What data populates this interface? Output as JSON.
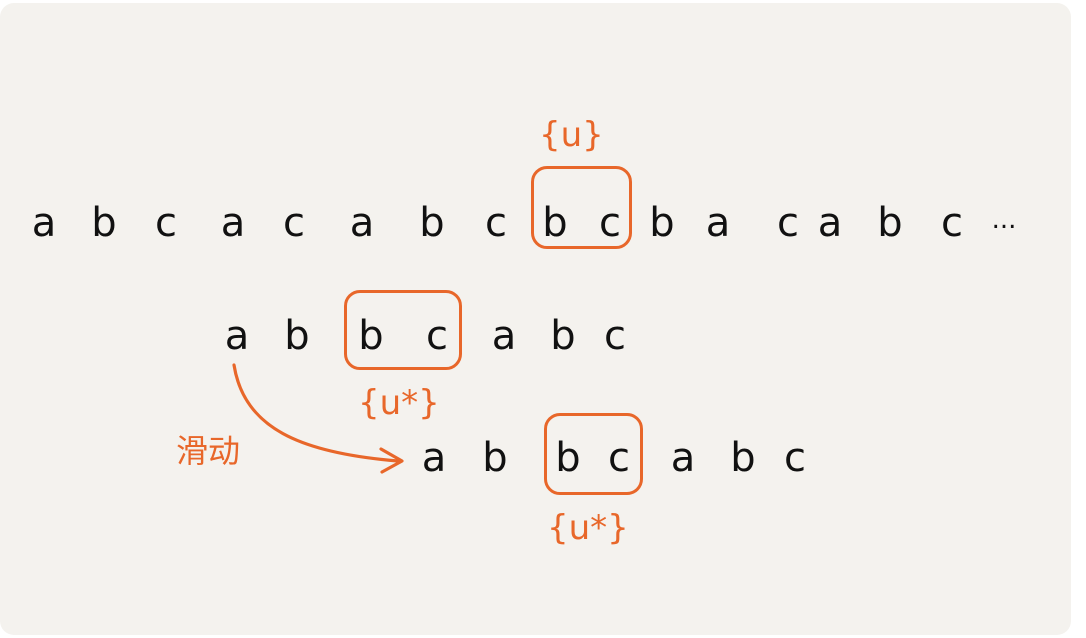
{
  "main_row": [
    "a",
    "b",
    "c",
    "a",
    "c",
    "a",
    "b",
    "c",
    "b",
    "c",
    "b",
    "a",
    "c",
    "a",
    "b",
    "c"
  ],
  "main_ellipsis": "...",
  "pattern_row_1": [
    "a",
    "b",
    "b",
    "c",
    "a",
    "b",
    "c"
  ],
  "pattern_row_2": [
    "a",
    "b",
    "b",
    "c",
    "a",
    "b",
    "c"
  ],
  "labels": {
    "u": "{u}",
    "u_star_upper": "{u*}",
    "u_star_lower": "{u*}",
    "slide": "滑动"
  },
  "colors": {
    "accent": "#e8672a",
    "text": "#111111",
    "background": "#f4f2ee"
  }
}
